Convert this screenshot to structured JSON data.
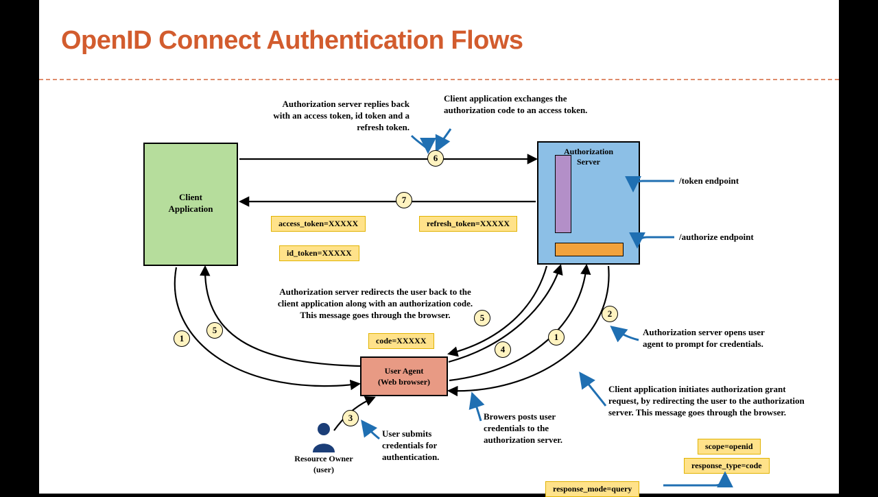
{
  "title": "OpenID Connect Authentication Flows",
  "nodes": {
    "client_app": "Client\nApplication",
    "auth_server": "Authorization\nServer",
    "user_agent": "User Agent\n(Web browser)",
    "resource_owner": "Resource Owner\n(user)"
  },
  "endpoints": {
    "token": "/token endpoint",
    "authorize": "/authorize endpoint"
  },
  "tokens": {
    "access": "access_token=XXXXX",
    "id": "id_token=XXXXX",
    "refresh": "refresh_token=XXXXX",
    "code": "code=XXXXX",
    "scope": "scope=openid",
    "response_type": "response_type=code",
    "response_mode": "response_mode=query"
  },
  "captions": {
    "c7": "Authorization server replies back with an access token, id token and a refresh token.",
    "c6": "Client application exchanges the authorization code to an access token.",
    "c5": "Authorization server redirects the user back to the client application along with an authorization code. This message goes through the browser.",
    "c4": "Browers posts user credentials to the authorization server.",
    "c3": "User submits credentials for authentication.",
    "c2": "Authorization server opens user agent to prompt for  credentials.",
    "c1": "Client application initiates authorization grant request, by redirecting the user to the authorization server. This message goes through the browser."
  },
  "steps": {
    "s1": "1",
    "s2": "2",
    "s3": "3",
    "s4": "4",
    "s5": "5",
    "s5b": "5",
    "s6": "6",
    "s7": "7",
    "s1b": "1"
  }
}
